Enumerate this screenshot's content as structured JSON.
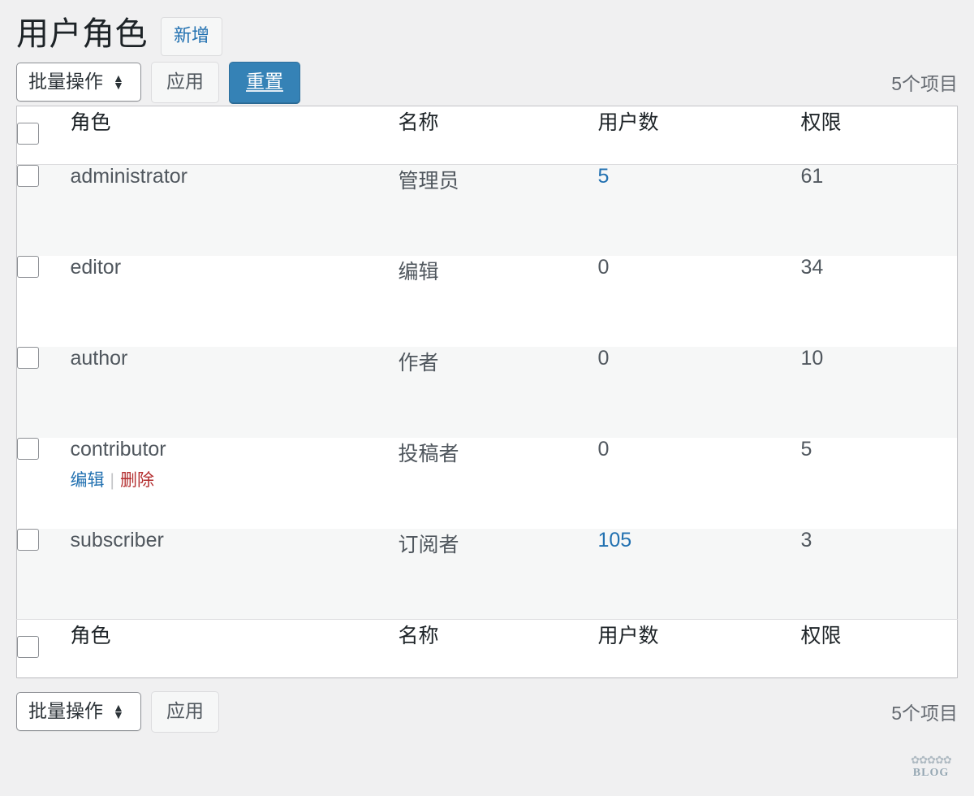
{
  "header": {
    "title": "用户角色",
    "add_new_label": "新增"
  },
  "toolbar_top": {
    "bulk_actions_label": "批量操作",
    "apply_label": "应用",
    "reset_label": "重置",
    "displaying_num": "5个项目",
    "select_arrows_up": "▲",
    "select_arrows_down": "▼"
  },
  "toolbar_bottom": {
    "bulk_actions_label": "批量操作",
    "apply_label": "应用",
    "displaying_num": "5个项目"
  },
  "table": {
    "columns": {
      "role": "角色",
      "name": "名称",
      "users": "用户数",
      "caps": "权限"
    },
    "rows": [
      {
        "role": "administrator",
        "name": "管理员",
        "users": "5",
        "users_is_link": true,
        "caps": "61",
        "actions": null
      },
      {
        "role": "editor",
        "name": "编辑",
        "users": "0",
        "users_is_link": false,
        "caps": "34",
        "actions": null
      },
      {
        "role": "author",
        "name": "作者",
        "users": "0",
        "users_is_link": false,
        "caps": "10",
        "actions": null
      },
      {
        "role": "contributor",
        "name": "投稿者",
        "users": "0",
        "users_is_link": false,
        "caps": "5",
        "actions": {
          "edit": "编辑",
          "separator": "|",
          "delete": "删除"
        }
      },
      {
        "role": "subscriber",
        "name": "订阅者",
        "users": "105",
        "users_is_link": true,
        "caps": "3",
        "actions": null
      }
    ]
  },
  "watermark": {
    "mark": "✿✿✿✿✿",
    "text": "BLOG"
  },
  "colors": {
    "link": "#2271b1",
    "delete": "#b32d2e",
    "primary_button_bg": "#3582b6",
    "page_bg": "#f0f0f1",
    "row_alt_bg": "#f6f7f7"
  }
}
